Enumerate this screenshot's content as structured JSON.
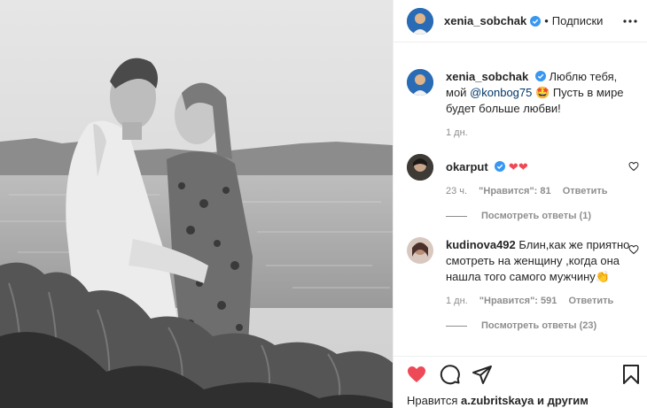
{
  "post": {
    "author": "xenia_sobchak",
    "follow_label": "Подписки",
    "dot": "•",
    "caption_prefix": "Люблю тебя, мой",
    "caption_mention": "@konbog75",
    "caption_emoji": "🤩",
    "caption_suffix": "Пусть в мире будет больше любви!",
    "caption_time": "1 дн."
  },
  "comments": [
    {
      "username": "okarput",
      "text": "❤❤",
      "time": "23 ч.",
      "likes": "\"Нравится\": 81",
      "reply": "Ответить",
      "view_replies": "Посмотреть ответы (1)"
    },
    {
      "username": "kudinova492",
      "text": "Блин,как же приятно смотреть на женщину ,когда она нашла того самого мужчину",
      "emoji": "👏",
      "time": "1 дн.",
      "likes": "\"Нравится\": 591",
      "reply": "Ответить",
      "view_replies": "Посмотреть ответы (23)"
    }
  ],
  "footer": {
    "likes_prefix": "Нравится",
    "likes_user": "a.zubritskaya",
    "likes_suffix": "и другим"
  },
  "colors": {
    "like_red": "#ed4956",
    "verified_blue": "#3897f0",
    "mention_blue": "#00376b",
    "meta_gray": "#8e8e8e"
  },
  "icons": {
    "verified": "verified-badge-icon",
    "more": "more-options-icon",
    "heart": "heart-icon",
    "comment": "comment-icon",
    "share": "share-icon",
    "bookmark": "bookmark-icon"
  }
}
